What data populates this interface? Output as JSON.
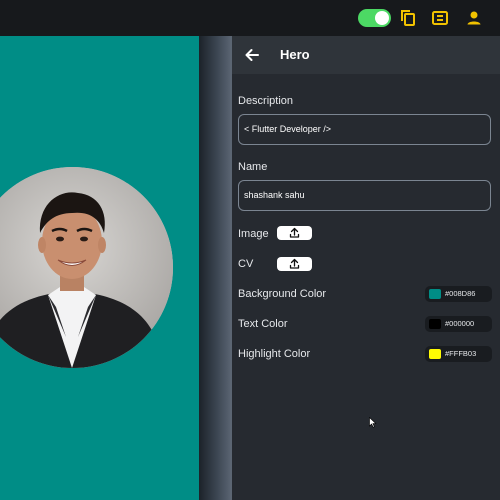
{
  "toolbar": {
    "toggle_on": true,
    "icons": [
      "copy-icon",
      "layout-icon",
      "person-icon"
    ],
    "icon_color": "#f2c200"
  },
  "preview": {
    "background": "#008D86",
    "photo": "profile-photo"
  },
  "panel": {
    "back_icon": "arrow-left-icon",
    "title": "Hero",
    "description_label": "Description",
    "description_value": "< Flutter Developer />",
    "name_label": "Name",
    "name_value": "shashank sahu",
    "image_label": "Image",
    "cv_label": "CV",
    "upload_icon": "upload-icon",
    "background_color_label": "Background Color",
    "background_color_value": "#008D86",
    "text_color_label": "Text Color",
    "text_color_value": "#000000",
    "highlight_color_label": "Highlight Color",
    "highlight_color_value": "#FFFB03"
  }
}
